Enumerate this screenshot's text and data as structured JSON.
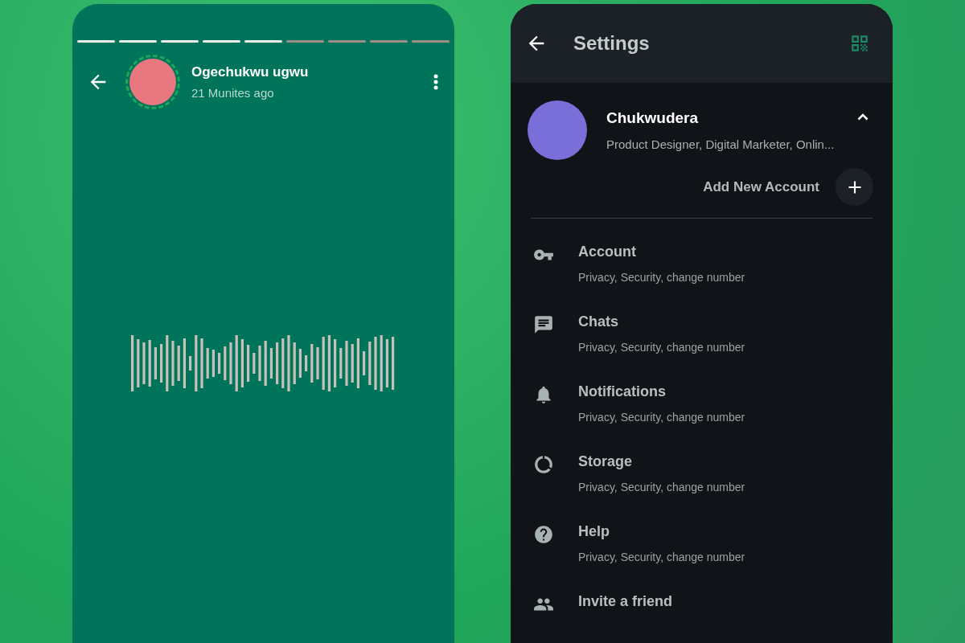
{
  "story": {
    "segments": [
      {
        "viewed": true
      },
      {
        "viewed": true
      },
      {
        "viewed": true
      },
      {
        "viewed": true
      },
      {
        "viewed": true
      },
      {
        "viewed": false
      },
      {
        "viewed": false
      },
      {
        "viewed": false
      },
      {
        "viewed": false
      }
    ],
    "name": "Ogechukwu ugwu",
    "time": "21 Munites ago"
  },
  "settings": {
    "title": "Settings",
    "profile": {
      "name": "Chukwudera",
      "about": "Product Designer, Digital Marketer, Onlin...",
      "expanded": true
    },
    "add_account": "Add New Account",
    "items": [
      {
        "kind": "account",
        "title": "Account",
        "subtitle": "Privacy, Security, change number"
      },
      {
        "kind": "chats",
        "title": "Chats",
        "subtitle": "Privacy, Security, change number"
      },
      {
        "kind": "notifications",
        "title": "Notifications",
        "subtitle": "Privacy, Security, change number"
      },
      {
        "kind": "storage",
        "title": "Storage",
        "subtitle": "Privacy, Security, change number"
      },
      {
        "kind": "help",
        "title": "Help",
        "subtitle": "Privacy, Security, change number"
      },
      {
        "kind": "invite",
        "title": "Invite a friend"
      }
    ]
  }
}
